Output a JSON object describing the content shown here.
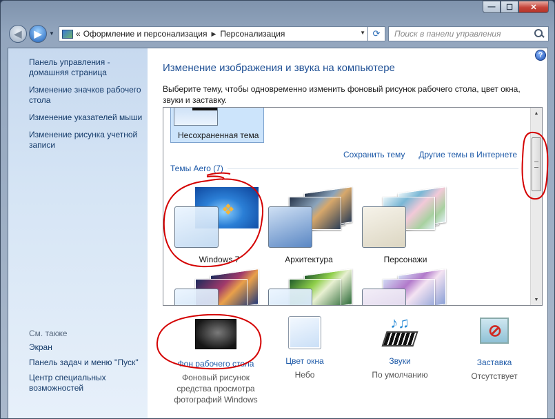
{
  "window": {
    "min_glyph": "—",
    "max_glyph": "☐",
    "close_glyph": "✕"
  },
  "nav": {
    "back_icon": "back-arrow-icon",
    "forward_icon": "forward-arrow-icon",
    "breadcrumb_prefix": "«",
    "breadcrumbs": [
      "Оформление и персонализация",
      "Персонализация"
    ],
    "refresh_glyph": "⟳",
    "search_placeholder": "Поиск в панели управления"
  },
  "sidebar": {
    "links": [
      "Панель управления - домашняя страница",
      "Изменение значков рабочего стола",
      "Изменение указателей мыши",
      "Изменение рисунка учетной записи"
    ],
    "see_also_header": "См. также",
    "see_also": [
      "Экран",
      "Панель задач и меню ''Пуск''",
      "Центр специальных возможностей"
    ]
  },
  "main": {
    "help_glyph": "?",
    "title": "Изменение изображения и звука на компьютере",
    "description": "Выберите тему, чтобы одновременно изменить фоновый рисунок рабочего стола, цвет окна, звуки и заставку.",
    "unsaved_theme": "Несохраненная тема",
    "save_theme": "Сохранить тему",
    "more_themes": "Другие темы в Интернете",
    "aero_header": "Темы Aero (7)",
    "themes": [
      "Windows 7",
      "Архитектура",
      "Персонажи"
    ],
    "scroll_up": "▲",
    "scroll_down": "▼"
  },
  "settings": [
    {
      "link": "Фон рабочего стола",
      "value": "Фоновый рисунок средства просмотра фотографий Windows",
      "icon": "wallpaper-icon"
    },
    {
      "link": "Цвет окна",
      "value": "Небо",
      "icon": "window-color-icon"
    },
    {
      "link": "Звуки",
      "value": "По умолчанию",
      "icon": "sounds-icon"
    },
    {
      "link": "Заставка",
      "value": "Отсутствует",
      "icon": "screensaver-icon"
    }
  ],
  "colors": {
    "link": "#1e5aa8",
    "title": "#1e4f94",
    "annotation": "#d40000",
    "selection": "#cce4fb"
  }
}
